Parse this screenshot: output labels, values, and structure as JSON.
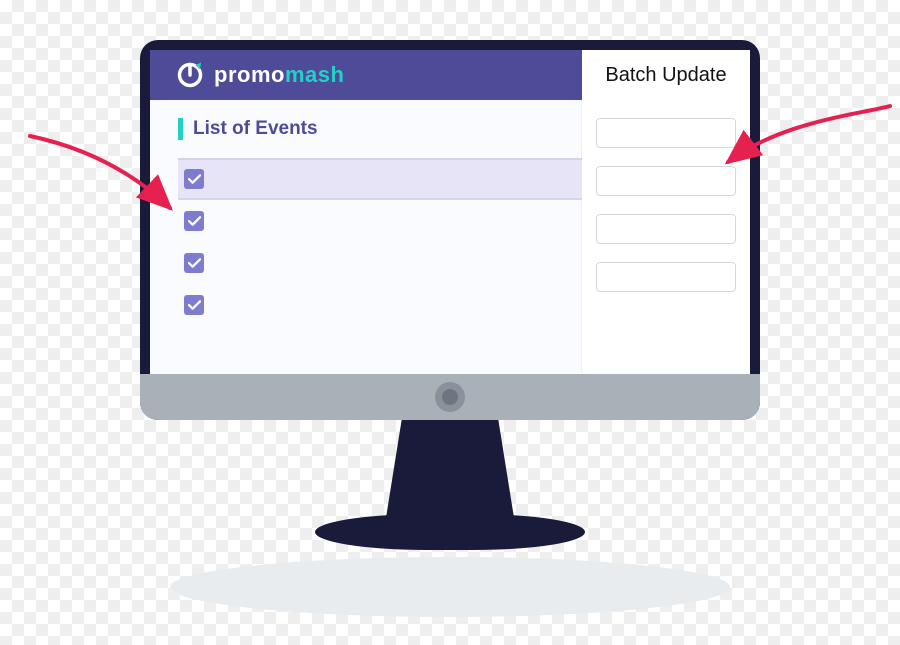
{
  "brand": {
    "part1": "promo",
    "part2": "mash"
  },
  "panel_title": "Batch Update",
  "list": {
    "title": "List of Events",
    "rows": [
      {
        "checked": true,
        "selected": true
      },
      {
        "checked": true,
        "selected": false
      },
      {
        "checked": true,
        "selected": false
      },
      {
        "checked": true,
        "selected": false
      }
    ]
  },
  "side_fields": [
    {
      "value": ""
    },
    {
      "value": ""
    },
    {
      "value": ""
    },
    {
      "value": ""
    }
  ],
  "colors": {
    "header": "#4e4b99",
    "accent": "#24d0c6",
    "checkbox": "#7e7ccf",
    "arrow": "#e6204f",
    "monitor": "#1a1b3a",
    "chin": "#aab0b8"
  }
}
